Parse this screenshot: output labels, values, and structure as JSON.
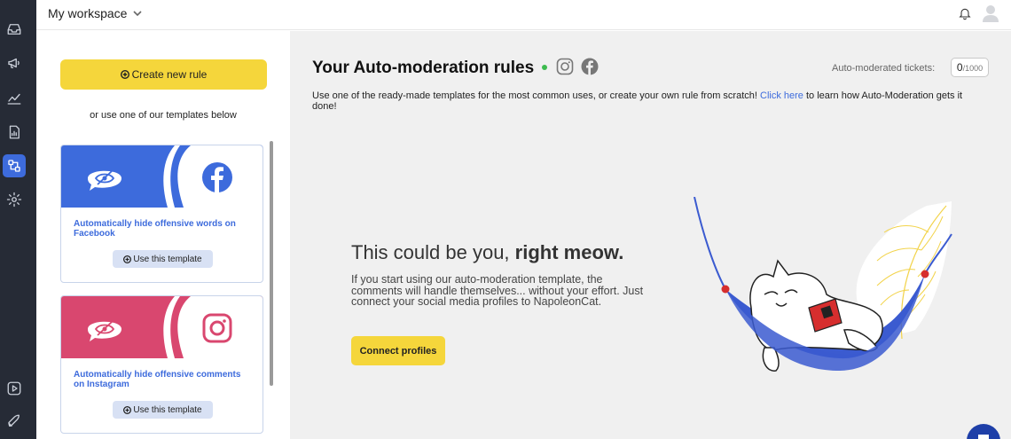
{
  "workspace": {
    "name": "My workspace"
  },
  "left_panel": {
    "create_button": "Create new rule",
    "templates_hint": "or use one of our templates below",
    "templates": [
      {
        "title": "Automatically hide offensive words on Facebook",
        "button": "Use this template",
        "platform": "facebook",
        "banner_color": "#3d6bdc"
      },
      {
        "title": "Automatically hide offensive comments on Instagram",
        "button": "Use this template",
        "platform": "instagram",
        "banner_color": "#d9476f"
      }
    ]
  },
  "main": {
    "title": "Your Auto-moderation rules",
    "tickets_label": "Auto-moderated tickets:",
    "tickets_count": "0",
    "tickets_max": "/1000",
    "description_pre": "Use one of the ready-made templates for the most common uses, or create your own rule from scratch!",
    "description_link": "Click here",
    "description_post": "to learn how Auto-Moderation gets it done!",
    "empty_headline_light": "This could be you,",
    "empty_headline_bold": "right meow.",
    "empty_body": "If you start using our auto-moderation template, the comments will handle themselves... without your effort. Just connect your social media profiles to NapoleonCat.",
    "connect_button": "Connect profiles"
  },
  "colors": {
    "accent": "#3d6bdc",
    "yellow": "#f5d63b",
    "nav_bg": "#262b36",
    "status_dot": "#3dbb4f"
  }
}
